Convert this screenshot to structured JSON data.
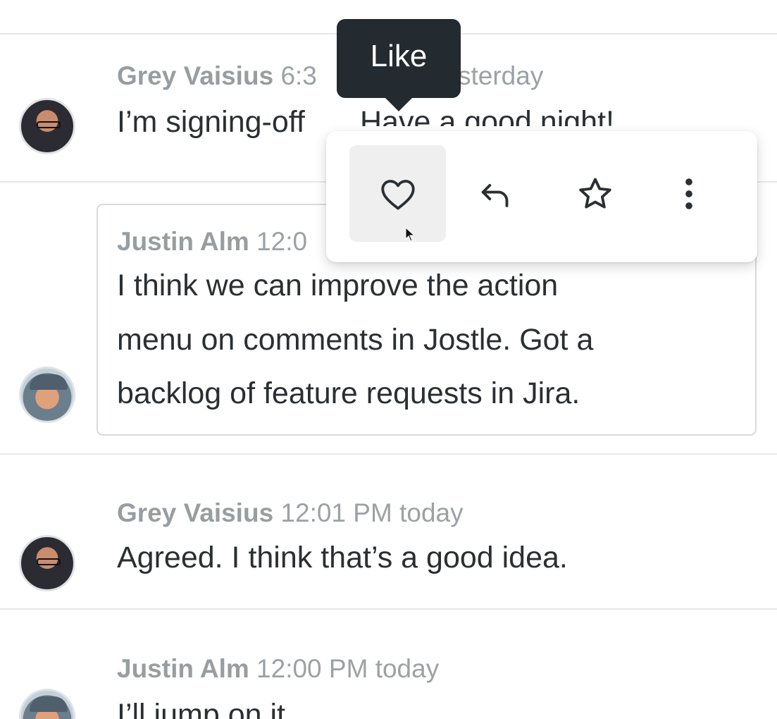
{
  "tooltip": {
    "text": "Like"
  },
  "action_menu": {
    "buttons": [
      {
        "label": "Like",
        "icon": "heart-icon",
        "hovered": true
      },
      {
        "label": "Reply",
        "icon": "reply-arrow-icon"
      },
      {
        "label": "Star",
        "icon": "star-icon"
      },
      {
        "label": "More",
        "icon": "more-vertical-icon"
      }
    ]
  },
  "messages": [
    {
      "author": "Grey Vaisius",
      "time": "6:3",
      "time_suffix": "sterday",
      "text_before": "I’m signing-off",
      "text_partial": "Have a good night!"
    },
    {
      "author": "Justin Alm",
      "time": "12:0",
      "lines": [
        "I think we can improve the action",
        "menu on comments in Jostle. Got a",
        "backlog of feature requests in Jira."
      ],
      "selected": true
    },
    {
      "author": "Grey Vaisius",
      "time": "12:01 PM today",
      "lines": [
        "Agreed. I think that’s a good idea."
      ]
    },
    {
      "author": "Justin Alm",
      "time": "12:00 PM today",
      "lines": [
        "I’ll jump on it"
      ]
    }
  ],
  "colors": {
    "tooltip_bg": "#232a30",
    "text": "#2b2f33",
    "meta": "#9ca1a5",
    "divider": "#e6e8ea",
    "hover_bg": "#efefef"
  }
}
